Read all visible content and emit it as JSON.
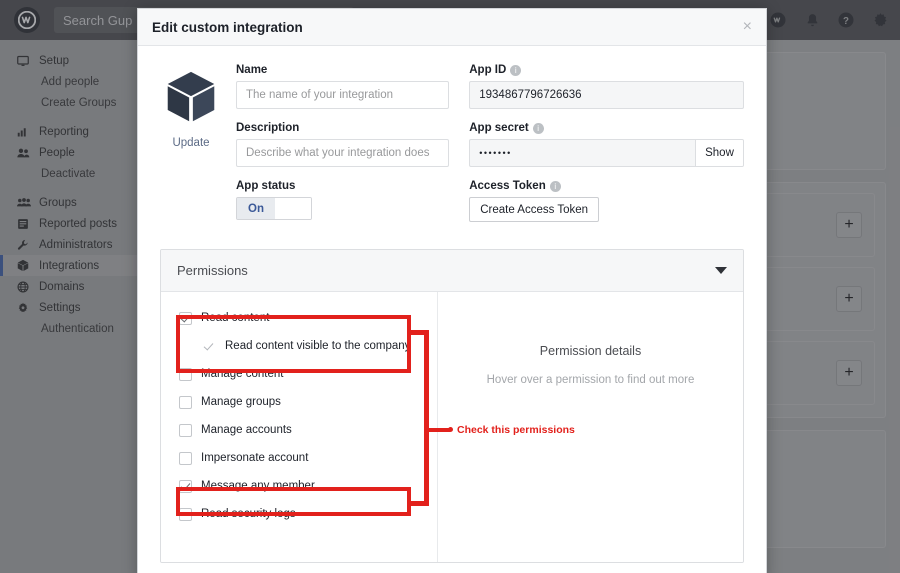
{
  "topbar": {
    "logo": "workplace-logo",
    "search_placeholder": "Search Gup",
    "icons": [
      {
        "name": "chat-icon",
        "glyph": "chat"
      },
      {
        "name": "notifications-bell-icon",
        "glyph": "bell"
      },
      {
        "name": "help-icon",
        "glyph": "help"
      },
      {
        "name": "settings-gear-icon",
        "glyph": "gear"
      }
    ]
  },
  "sidebar": {
    "items": [
      {
        "label": "Setup",
        "icon": "monitor-icon",
        "sub": false,
        "active": false
      },
      {
        "label": "Add people",
        "icon": "",
        "sub": true,
        "active": false
      },
      {
        "label": "Create Groups",
        "icon": "",
        "sub": true,
        "active": false
      },
      {
        "label": "Reporting",
        "icon": "chart-bars-icon",
        "sub": false,
        "active": false
      },
      {
        "label": "People",
        "icon": "people-icon",
        "sub": false,
        "active": false
      },
      {
        "label": "Deactivate",
        "icon": "",
        "sub": true,
        "active": false
      },
      {
        "label": "Groups",
        "icon": "groups-icon",
        "sub": false,
        "active": false
      },
      {
        "label": "Reported posts",
        "icon": "document-icon",
        "sub": false,
        "active": false
      },
      {
        "label": "Administrators",
        "icon": "wrench-icon",
        "sub": false,
        "active": false
      },
      {
        "label": "Integrations",
        "icon": "cube-icon",
        "sub": false,
        "active": true
      },
      {
        "label": "Domains",
        "icon": "globe-icon",
        "sub": false,
        "active": false
      },
      {
        "label": "Settings",
        "icon": "gear-icon",
        "sub": false,
        "active": false
      },
      {
        "label": "Authentication",
        "icon": "",
        "sub": true,
        "active": false
      }
    ]
  },
  "background": {
    "plus_label": "+",
    "row_count": 3
  },
  "modal": {
    "title": "Edit custom integration",
    "close_label": "×",
    "app_icon_name": "cube-icon",
    "update_label": "Update",
    "fields": {
      "name_label": "Name",
      "name_value": "",
      "name_placeholder": "The name of your integration",
      "description_label": "Description",
      "description_value": "",
      "description_placeholder": "Describe what your integration does",
      "app_status_label": "App status",
      "app_status_value": "On",
      "app_id_label": "App ID",
      "app_id_value": "1934867796726636",
      "app_secret_label": "App secret",
      "app_secret_value": "•••••••",
      "show_label": "Show",
      "access_token_label": "Access Token",
      "create_token_label": "Create Access Token"
    },
    "permissions": {
      "section_title": "Permissions",
      "caret": "chevron-down-icon",
      "items": [
        {
          "label": "Read content",
          "checked": true,
          "child": false,
          "style": "box"
        },
        {
          "label": "Read content visible to the company",
          "checked": true,
          "child": true,
          "style": "plain"
        },
        {
          "label": "Manage content",
          "checked": false,
          "child": false,
          "style": "box"
        },
        {
          "label": "Manage groups",
          "checked": false,
          "child": false,
          "style": "box"
        },
        {
          "label": "Manage accounts",
          "checked": false,
          "child": false,
          "style": "box"
        },
        {
          "label": "Impersonate account",
          "checked": false,
          "child": false,
          "style": "box"
        },
        {
          "label": "Message any member",
          "checked": true,
          "child": false,
          "style": "box"
        },
        {
          "label": "Read security logs",
          "checked": false,
          "child": false,
          "style": "box"
        }
      ],
      "details_title": "Permission details",
      "details_subtitle": "Hover over a permission to find out more"
    }
  },
  "annotations": {
    "label": "Check this permissions",
    "color": "#e2211c"
  }
}
